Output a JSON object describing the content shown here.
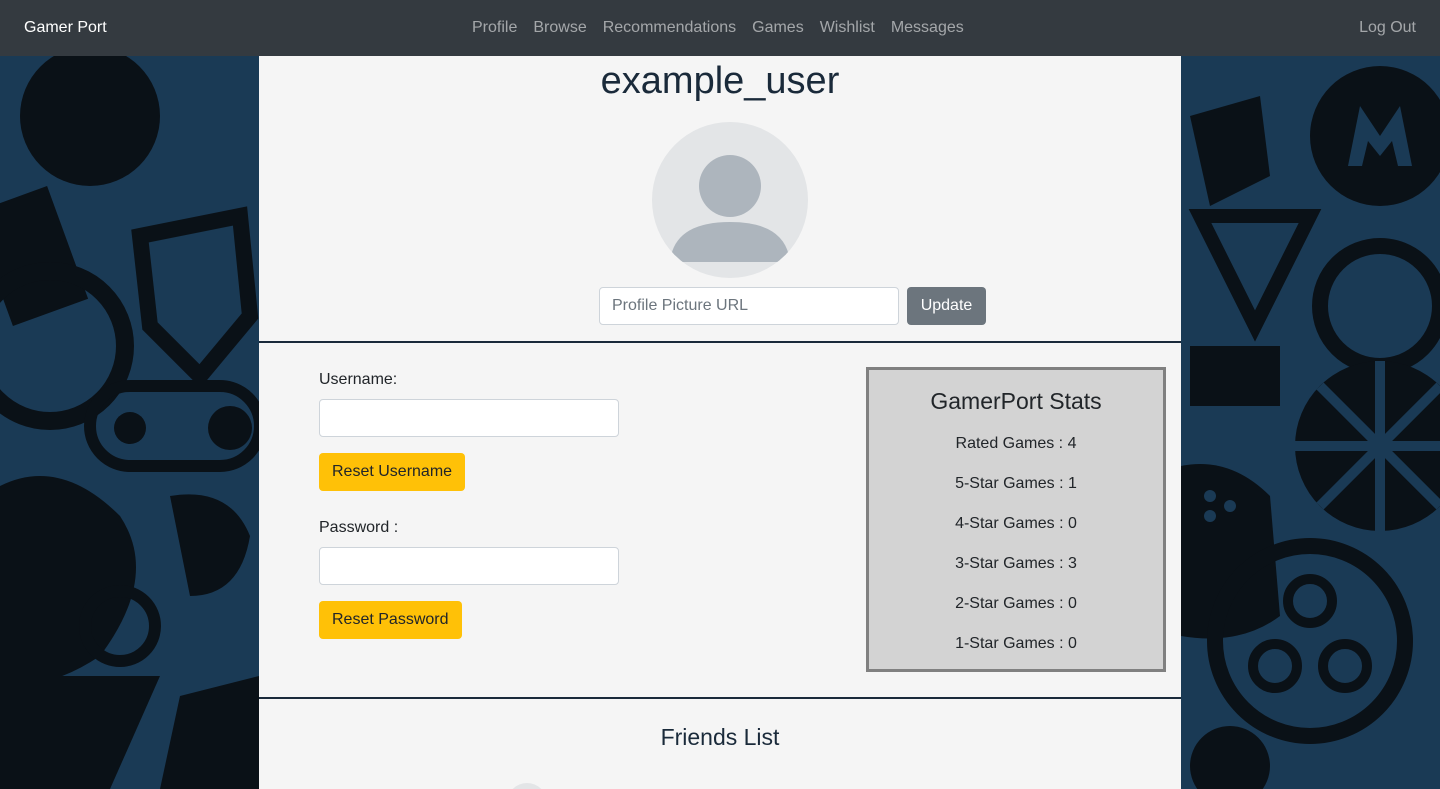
{
  "navbar": {
    "brand": "Gamer Port",
    "links": [
      "Profile",
      "Browse",
      "Recommendations",
      "Games",
      "Wishlist",
      "Messages"
    ],
    "logout": "Log Out"
  },
  "profile": {
    "username": "example_user",
    "avatar_icon": "user-silhouette-icon",
    "picture_url_placeholder": "Profile Picture URL",
    "update_label": "Update"
  },
  "account": {
    "username_label": "Username:",
    "reset_username_label": "Reset Username",
    "password_label": "Password :",
    "reset_password_label": "Reset Password"
  },
  "stats": {
    "title": "GamerPort Stats",
    "rows": [
      "Rated Games : 4",
      "5-Star Games : 1",
      "4-Star Games : 0",
      "3-Star Games : 3",
      "2-Star Games : 0",
      "1-Star Games : 0"
    ]
  },
  "friends": {
    "title": "Friends List"
  },
  "colors": {
    "navbar": "#343a40",
    "panel": "#f5f5f5",
    "warning": "#ffc107",
    "secondary": "#6c757d",
    "stats_bg": "#d3d3d3",
    "background": "#1a3a55"
  }
}
